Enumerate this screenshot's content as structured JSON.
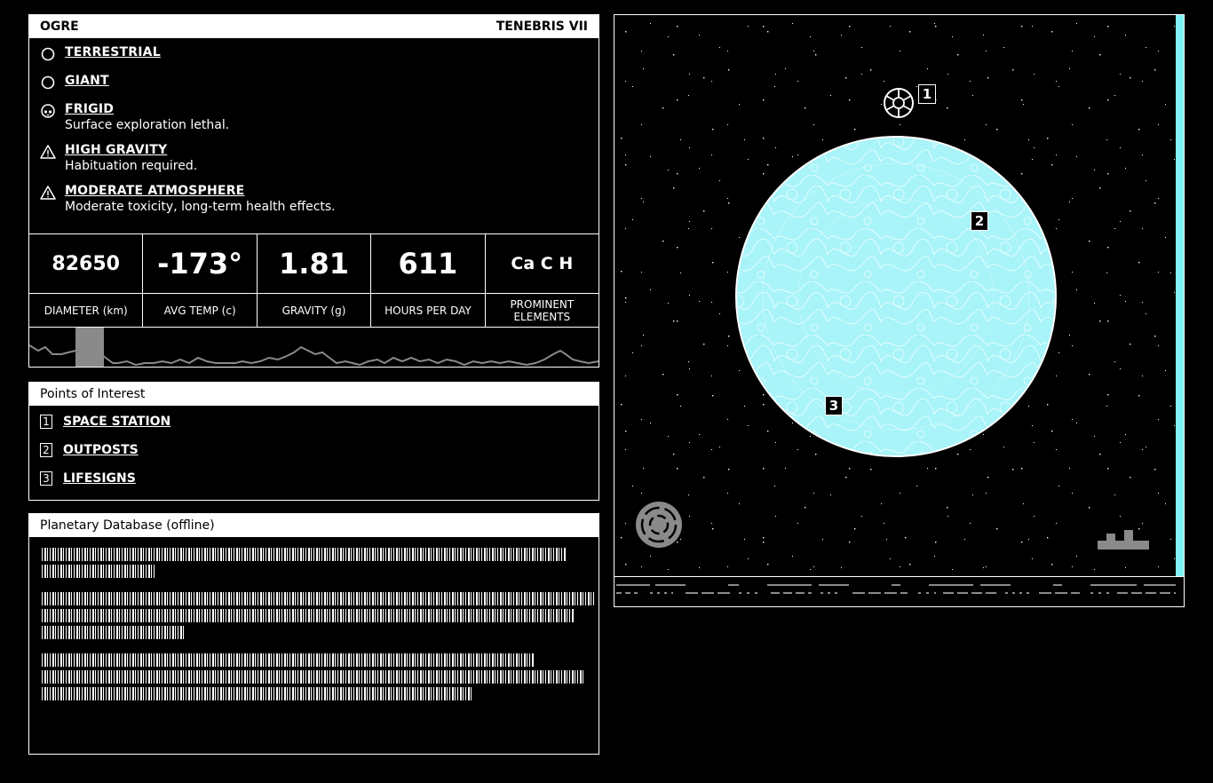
{
  "planet": {
    "name": "OGRE",
    "system": "TENEBRIS VII"
  },
  "traits": [
    {
      "name": "TERRESTRIAL",
      "desc": "",
      "icon": "circle-icon"
    },
    {
      "name": "GIANT",
      "desc": "",
      "icon": "circle-icon"
    },
    {
      "name": "FRIGID",
      "desc": "Surface exploration lethal.",
      "icon": "skull-icon"
    },
    {
      "name": "HIGH GRAVITY",
      "desc": "Habituation required.",
      "icon": "warning-icon"
    },
    {
      "name": "MODERATE ATMOSPHERE",
      "desc": "Moderate toxicity, long-term health effects.",
      "icon": "warning-icon"
    }
  ],
  "stats": [
    {
      "value": "82650",
      "label": "DIAMETER (km)"
    },
    {
      "value": "-173°",
      "label": "AVG TEMP (c)"
    },
    {
      "value": "1.81",
      "label": "GRAVITY (g)"
    },
    {
      "value": "611",
      "label": "HOURS PER DAY"
    },
    {
      "value": "Ca C H",
      "label": "PROMINENT ELEMENTS"
    }
  ],
  "points_of_interest": {
    "title": "Points of Interest",
    "items": [
      {
        "num": "1",
        "name": "SPACE STATION"
      },
      {
        "num": "2",
        "name": "OUTPOSTS"
      },
      {
        "num": "3",
        "name": "LIFESIGNS"
      }
    ]
  },
  "database": {
    "title": "Planetary Database (offline)"
  },
  "colors": {
    "planet": "#a8f4f8",
    "accent": "#7ff3f7",
    "graph": "#8a8a8a"
  }
}
